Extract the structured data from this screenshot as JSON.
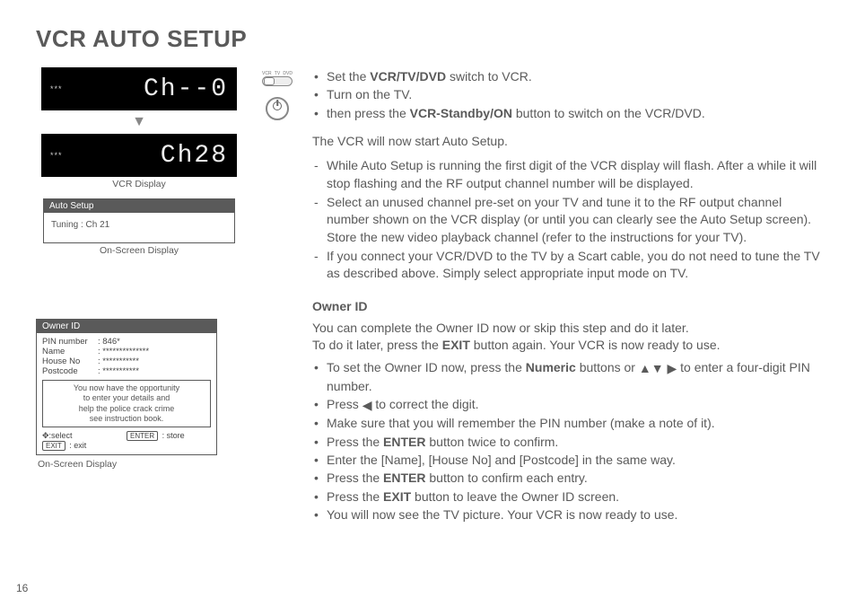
{
  "title": "VCR AUTO SETUP",
  "page_number": "16",
  "left": {
    "vcr1_dots": "***",
    "vcr1_seg": "Ch--0",
    "vcr2_dots": "***",
    "vcr2_seg": "Ch28",
    "vcr_caption": "VCR Display",
    "osd1_title": "Auto Setup",
    "osd1_line": "Tuning            :   Ch  21",
    "osd1_caption": "On-Screen Display",
    "owner_title": "Owner ID",
    "owner_fields": {
      "pin_lab": "PIN number",
      "pin_val": ": 846*",
      "name_lab": "Name",
      "name_val": ": **************",
      "house_lab": "House No",
      "house_val": ": ***********",
      "post_lab": "Postcode",
      "post_val": ": ***********"
    },
    "owner_msg1": "You now have the opportunity",
    "owner_msg2": "to enter your details and",
    "owner_msg3": "help the police crack crime",
    "owner_msg4": "see instruction book.",
    "owner_foot_select": ":select",
    "owner_foot_enter_k": "ENTER",
    "owner_foot_enter": " : store",
    "owner_foot_exit_k": "EXIT",
    "owner_foot_exit": " : exit",
    "owner_caption": "On-Screen Display"
  },
  "icons": {
    "sw_vcr": "VCR",
    "sw_tv": "TV",
    "sw_dvd": "DVD"
  },
  "right": {
    "b1a": "Set the ",
    "b1b": "VCR/TV/DVD",
    "b1c": " switch to VCR.",
    "b2": "Turn on the TV.",
    "b3a": "then press the ",
    "b3b": "VCR-Standby/ON",
    "b3c": " button to switch on the VCR/DVD.",
    "p1": "The VCR will now start Auto Setup.",
    "d1": "While Auto Setup is running the first digit of the VCR display will flash. After a while it will stop flashing and the RF output channel number will be displayed.",
    "d2": "Select an unused channel pre-set on your TV and tune it to the RF output channel number shown on the VCR display (or until you can clearly see the Auto Setup screen). Store the new video playback channel (refer to the instructions for your TV).",
    "d3": "If you connect your VCR/DVD to the TV by a Scart cable, you do not need to tune the TV as described above. Simply select appropriate input mode on TV.",
    "owner_h": "Owner ID",
    "o_p1": "You can complete the Owner ID now or skip this step and do it later.",
    "o_p2a": "To do it later, press the ",
    "o_p2b": "EXIT",
    "o_p2c": " button again. Your VCR is now ready to use.",
    "ob1a": "To set the Owner ID now, press the ",
    "ob1b": "Numeric",
    "ob1c": " buttons or ",
    "ob1d": " to enter a four-digit PIN number.",
    "ob2a": "Press ",
    "ob2b": " to correct the digit.",
    "ob3": "Make sure that you will remember the PIN number (make a note of it).",
    "ob4a": "Press the ",
    "ob4b": "ENTER",
    "ob4c": " button twice to confirm.",
    "ob5": "Enter the [Name], [House No] and [Postcode] in the same way.",
    "ob6a": "Press the ",
    "ob6b": "ENTER",
    "ob6c": " button to confirm each entry.",
    "ob7a": "Press the ",
    "ob7b": "EXIT",
    "ob7c": " button to leave the Owner ID screen.",
    "ob8": "You will now see the TV picture. Your VCR is now ready to use."
  }
}
